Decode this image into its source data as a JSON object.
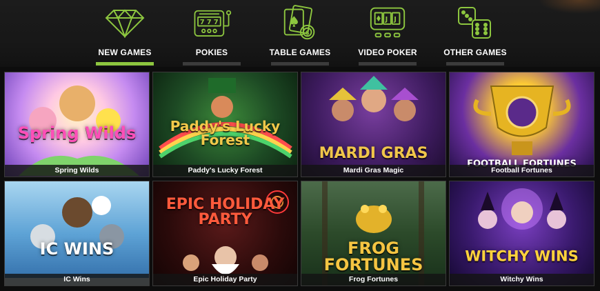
{
  "nav": {
    "tabs": [
      {
        "label": "NEW GAMES",
        "icon": "diamond-icon",
        "active": true
      },
      {
        "label": "POKIES",
        "icon": "slot-machine-icon",
        "active": false
      },
      {
        "label": "TABLE GAMES",
        "icon": "cards-chip-icon",
        "active": false
      },
      {
        "label": "VIDEO POKER",
        "icon": "video-poker-icon",
        "active": false
      },
      {
        "label": "OTHER GAMES",
        "icon": "dice-icon",
        "active": false
      }
    ],
    "accent_color": "#8dc63f"
  },
  "games": [
    {
      "title": "Spring Wilds",
      "logo": "Spring Wilds"
    },
    {
      "title": "Paddy's Lucky Forest",
      "logo": "Paddy's Lucky Forest"
    },
    {
      "title": "Mardi Gras Magic",
      "logo": "MARDI GRAS"
    },
    {
      "title": "Football Fortunes",
      "logo": "FOOTBALL FORTUNES"
    },
    {
      "title": "IC Wins",
      "logo": "IC WINS"
    },
    {
      "title": "Epic Holiday Party",
      "logo": "EPIC HOLIDAY PARTY"
    },
    {
      "title": "Frog Fortunes",
      "logo": "FROG FORTUNES"
    },
    {
      "title": "Witchy Wins",
      "logo": "WITCHY WINS"
    }
  ]
}
